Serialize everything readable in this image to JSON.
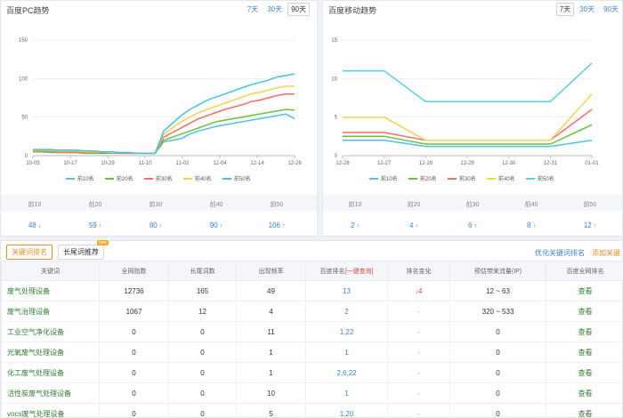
{
  "pc": {
    "title": "百度PC趋势",
    "ranges": [
      "7天",
      "30天",
      "90天"
    ],
    "active_range": 2,
    "summary": [
      {
        "label": "前10",
        "value": "48",
        "trend": "down"
      },
      {
        "label": "前20",
        "value": "59",
        "trend": "up"
      },
      {
        "label": "前30",
        "value": "80",
        "trend": "up"
      },
      {
        "label": "前40",
        "value": "90",
        "trend": "up"
      },
      {
        "label": "前50",
        "value": "106",
        "trend": "up"
      }
    ]
  },
  "mobile": {
    "title": "百度移动趋势",
    "ranges": [
      "7天",
      "30天",
      "90天"
    ],
    "active_range": 0,
    "summary": [
      {
        "label": "前10",
        "value": "2",
        "trend": "up"
      },
      {
        "label": "前20",
        "value": "4",
        "trend": "up"
      },
      {
        "label": "前30",
        "value": "6",
        "trend": "up"
      },
      {
        "label": "前40",
        "value": "8",
        "trend": "up"
      },
      {
        "label": "前50",
        "value": "12",
        "trend": "up"
      }
    ]
  },
  "chart_data": [
    {
      "type": "line",
      "title": "百度PC趋势",
      "x": [
        "10-05",
        "10-17",
        "10-29",
        "11-10",
        "11-02",
        "12-04",
        "12-14",
        "12-28"
      ],
      "yticks": [
        0,
        50,
        100,
        150
      ],
      "ylim": [
        0,
        150
      ],
      "grid": true,
      "legend_position": "bottom",
      "series": [
        {
          "name": "前10名",
          "color": "#4cc4e8",
          "values": [
            5,
            5,
            4,
            4,
            4,
            4,
            3,
            3,
            3,
            3,
            3,
            3,
            3,
            3,
            3,
            18,
            20,
            22,
            28,
            32,
            35,
            38,
            40,
            42,
            44,
            46,
            48,
            50,
            52,
            54,
            48
          ]
        },
        {
          "name": "前20名",
          "color": "#67c23a",
          "values": [
            5,
            5,
            5,
            4,
            4,
            4,
            3,
            3,
            3,
            3,
            3,
            3,
            3,
            3,
            3,
            20,
            24,
            28,
            32,
            36,
            40,
            44,
            46,
            48,
            50,
            52,
            54,
            56,
            58,
            60,
            59
          ]
        },
        {
          "name": "前30名",
          "color": "#f56c6c",
          "values": [
            6,
            6,
            6,
            5,
            5,
            5,
            4,
            4,
            4,
            4,
            3,
            3,
            3,
            3,
            3,
            24,
            30,
            36,
            42,
            48,
            52,
            56,
            60,
            63,
            66,
            70,
            72,
            75,
            78,
            80,
            80
          ]
        },
        {
          "name": "前40名",
          "color": "#f5d34a",
          "values": [
            7,
            7,
            7,
            6,
            6,
            6,
            5,
            5,
            5,
            4,
            4,
            4,
            3,
            3,
            3,
            28,
            36,
            44,
            50,
            56,
            60,
            64,
            68,
            72,
            76,
            80,
            82,
            85,
            88,
            90,
            90
          ]
        },
        {
          "name": "前50名",
          "color": "#3bc4e5",
          "values": [
            8,
            8,
            8,
            7,
            7,
            7,
            6,
            6,
            5,
            5,
            4,
            4,
            3,
            3,
            3,
            32,
            42,
            52,
            60,
            66,
            72,
            76,
            80,
            84,
            88,
            92,
            95,
            98,
            102,
            104,
            106
          ]
        }
      ]
    },
    {
      "type": "line",
      "title": "百度移动趋势",
      "x": [
        "12-26",
        "12-27",
        "12-28",
        "12-29",
        "12-30",
        "12-31",
        "01-01"
      ],
      "yticks": [
        0,
        5,
        10,
        15
      ],
      "ylim": [
        0,
        15
      ],
      "grid": true,
      "legend_position": "bottom",
      "series": [
        {
          "name": "前10名",
          "color": "#4cc4e8",
          "values": [
            2,
            2,
            1.2,
            1.2,
            1.2,
            1.2,
            2
          ]
        },
        {
          "name": "前20名",
          "color": "#67c23a",
          "values": [
            2.5,
            2.5,
            1.5,
            1.5,
            1.5,
            1.5,
            4
          ]
        },
        {
          "name": "前30名",
          "color": "#f56c6c",
          "values": [
            3,
            3,
            2,
            2,
            2,
            2,
            6
          ]
        },
        {
          "name": "前40名",
          "color": "#f5d34a",
          "values": [
            5,
            5,
            2,
            2,
            2,
            2,
            8
          ]
        },
        {
          "name": "前50名",
          "color": "#4fd0ec",
          "values": [
            11,
            11,
            7,
            7,
            7,
            7,
            12
          ]
        }
      ]
    }
  ],
  "table_panel": {
    "tabs": [
      {
        "label": "关键词排名",
        "active": true
      },
      {
        "label": "长尾词推荐",
        "active": false,
        "badge": "new"
      }
    ],
    "link_optimize": "优化关键词排名",
    "link_add": "添加关键",
    "headers": [
      "关键词",
      "全网指数",
      "长尾词数",
      "出现频率",
      "百度排名",
      "[一键查询]",
      "排名变化",
      "预估带来流量(IP)",
      "百度全网排名"
    ],
    "rows": [
      {
        "kw": "废气处理设备",
        "index": "12736",
        "tail": "165",
        "freq": "49",
        "rank": "13",
        "change": "4",
        "change_dir": "down",
        "flow": "12 ~ 63",
        "action": "查看"
      },
      {
        "kw": "废气治理设备",
        "index": "1067",
        "tail": "12",
        "freq": "4",
        "rank": "2",
        "change": "-",
        "change_dir": "none",
        "flow": "320 ~ 533",
        "action": "查看"
      },
      {
        "kw": "工业空气净化设备",
        "index": "0",
        "tail": "0",
        "freq": "11",
        "rank": "1,22",
        "change": "-",
        "change_dir": "none",
        "flow": "0",
        "action": "查看"
      },
      {
        "kw": "光氧废气处理设备",
        "index": "0",
        "tail": "0",
        "freq": "1",
        "rank": "1",
        "change": "-",
        "change_dir": "none",
        "flow": "0",
        "action": "查看"
      },
      {
        "kw": "化工废气处理设备",
        "index": "0",
        "tail": "0",
        "freq": "1",
        "rank": "2,6,22",
        "change": "-",
        "change_dir": "none",
        "flow": "0",
        "action": "查看"
      },
      {
        "kw": "活性炭废气处理设备",
        "index": "0",
        "tail": "0",
        "freq": "10",
        "rank": "1",
        "change": "-",
        "change_dir": "none",
        "flow": "0",
        "action": "查看"
      },
      {
        "kw": "vocs废气处理设备",
        "index": "0",
        "tail": "0",
        "freq": "5",
        "rank": "1,20",
        "change": "-",
        "change_dir": "none",
        "flow": "0",
        "action": "查看"
      }
    ]
  }
}
